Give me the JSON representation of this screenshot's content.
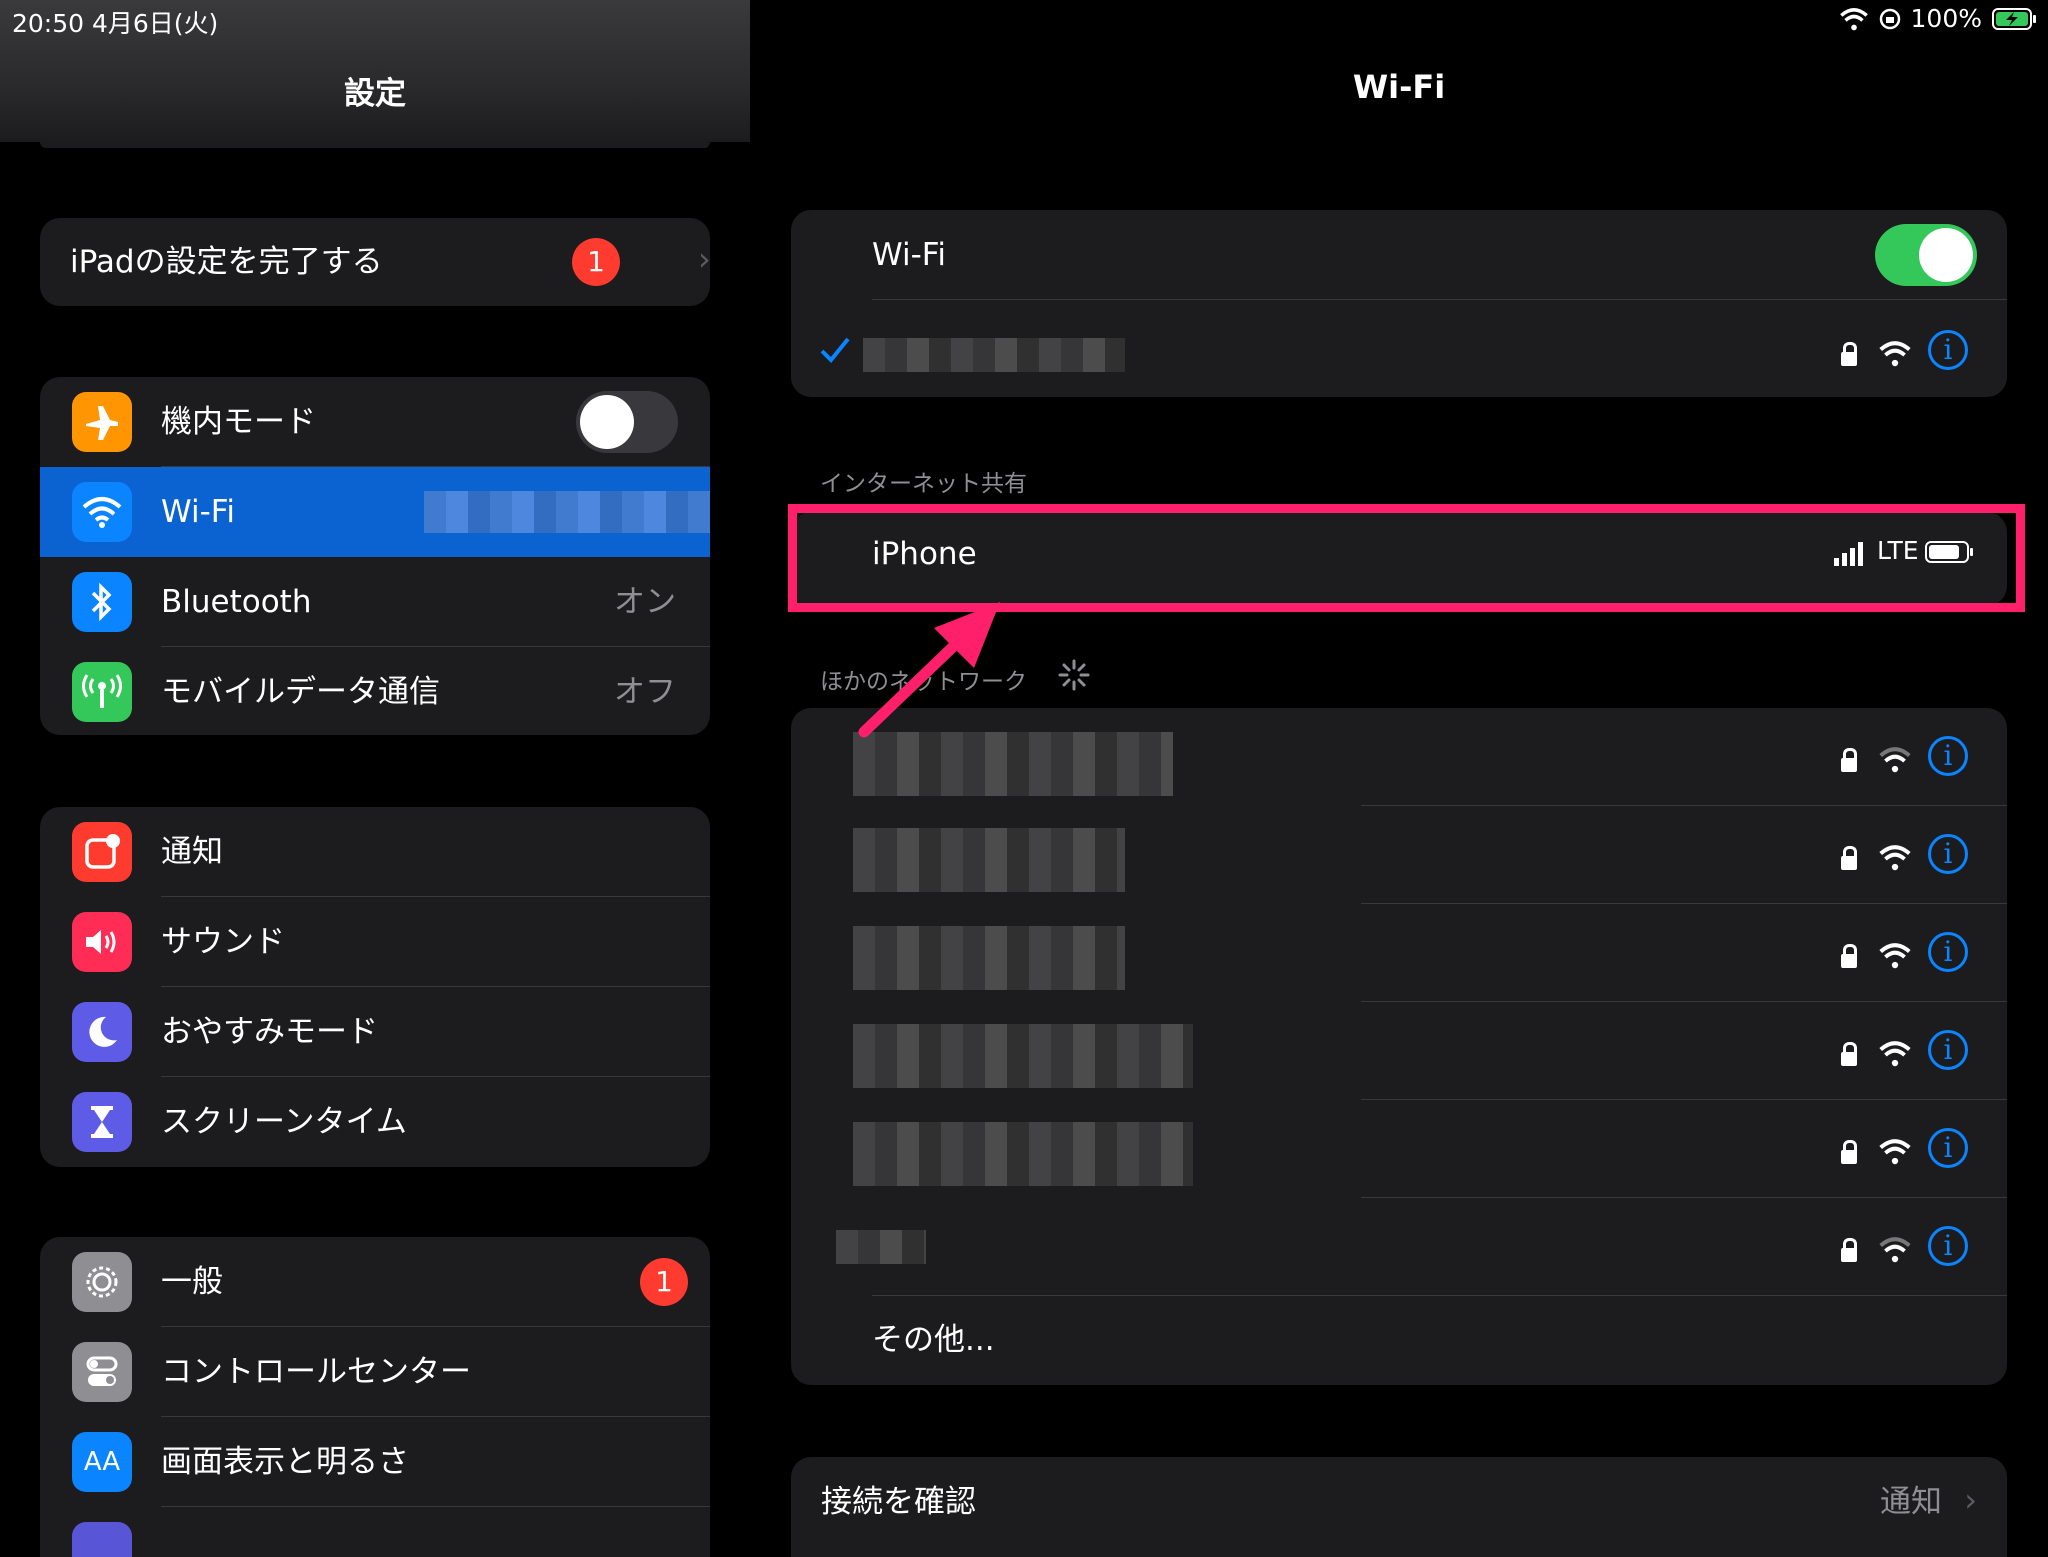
{
  "status_bar": {
    "time_date": "20:50   4月6日(火)",
    "battery_percent": "100%"
  },
  "sidebar": {
    "title": "設定",
    "setup": {
      "label": "iPadの設定を完了する",
      "badge": "1"
    },
    "group1": [
      {
        "label": "機内モード",
        "icon": "airplane-icon",
        "color": "#ff9500",
        "toggle": false
      },
      {
        "label": "Wi-Fi",
        "icon": "wifi-icon",
        "color": "#0a84ff",
        "selected": true
      },
      {
        "label": "Bluetooth",
        "icon": "bluetooth-icon",
        "color": "#0a84ff",
        "value": "オン"
      },
      {
        "label": "モバイルデータ通信",
        "icon": "antenna-icon",
        "color": "#34c759",
        "value": "オフ"
      }
    ],
    "group2": [
      {
        "label": "通知",
        "icon": "notifications-icon",
        "color": "#ff3b30"
      },
      {
        "label": "サウンド",
        "icon": "speaker-icon",
        "color": "#ff2d55"
      },
      {
        "label": "おやすみモード",
        "icon": "moon-icon",
        "color": "#5e5ce6"
      },
      {
        "label": "スクリーンタイム",
        "icon": "hourglass-icon",
        "color": "#5e5ce6"
      }
    ],
    "group3": [
      {
        "label": "一般",
        "icon": "gear-icon",
        "color": "#8e8e93",
        "badge": "1"
      },
      {
        "label": "コントロールセンター",
        "icon": "toggles-icon",
        "color": "#8e8e93"
      },
      {
        "label": "画面表示と明るさ",
        "icon": "text-size-icon",
        "color": "#0a84ff",
        "glyph": "AA"
      }
    ]
  },
  "main": {
    "title": "Wi-Fi",
    "wifi_label": "Wi-Fi",
    "wifi_on": true,
    "hotspot_section": "インターネット共有",
    "hotspot": {
      "name": "iPhone",
      "network_type": "LTE"
    },
    "other_section": "ほかのネットワーク",
    "other_label": "その他...",
    "ask_to_join": {
      "label": "接続を確認",
      "value": "通知"
    }
  }
}
